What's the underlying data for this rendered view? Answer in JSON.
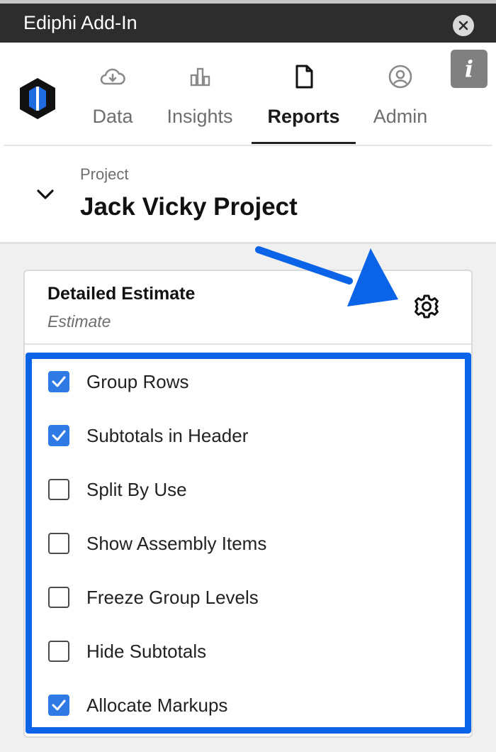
{
  "window": {
    "title": "Ediphi Add-In"
  },
  "nav": {
    "tabs": [
      {
        "label": "Data",
        "icon": "cloud-download-icon"
      },
      {
        "label": "Insights",
        "icon": "bar-chart-icon"
      },
      {
        "label": "Reports",
        "icon": "document-icon",
        "active": true
      },
      {
        "label": "Admin",
        "icon": "user-circle-icon"
      }
    ],
    "info_label": "i"
  },
  "project": {
    "label": "Project",
    "name": "Jack Vicky Project"
  },
  "report": {
    "title": "Detailed Estimate",
    "subtitle": "Estimate",
    "options": [
      {
        "label": "Group Rows",
        "checked": true
      },
      {
        "label": "Subtotals in Header",
        "checked": true
      },
      {
        "label": "Split By Use",
        "checked": false
      },
      {
        "label": "Show Assembly Items",
        "checked": false
      },
      {
        "label": "Freeze Group Levels",
        "checked": false
      },
      {
        "label": "Hide Subtotals",
        "checked": false
      },
      {
        "label": "Allocate Markups",
        "checked": true
      }
    ]
  },
  "colors": {
    "highlight": "#0b63e8",
    "checkbox_on": "#2f7ae5",
    "titlebar": "#2d2d2d"
  }
}
